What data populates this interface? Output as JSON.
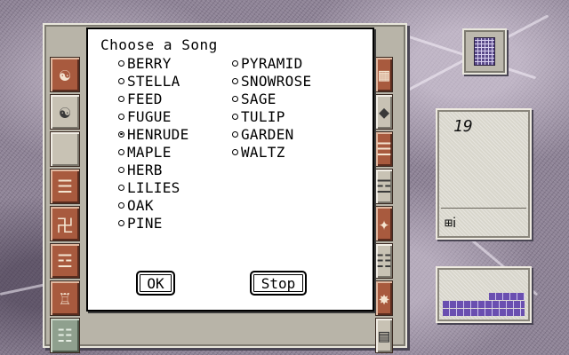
{
  "dialog": {
    "title": "Choose a Song",
    "selected": "HENRUDE",
    "songs_left": [
      "BERRY",
      "STELLA",
      "FEED",
      "FUGUE",
      "HENRUDE",
      "MAPLE",
      "HERB",
      "LILIES",
      "OAK",
      "PINE"
    ],
    "songs_right": [
      "PYRAMID",
      "SNOWROSE",
      "SAGE",
      "TULIP",
      "GARDEN",
      "WALTZ"
    ],
    "ok_label": "OK",
    "stop_label": "Stop"
  },
  "counter": {
    "value": "19",
    "icon": "tile-pair-icon"
  },
  "tray": {
    "fill_level": 0.45
  },
  "colors": {
    "dialog_bg": "#ffffff",
    "tile_red": "#a85a3e",
    "tray_purple": "#6a4fb0"
  }
}
